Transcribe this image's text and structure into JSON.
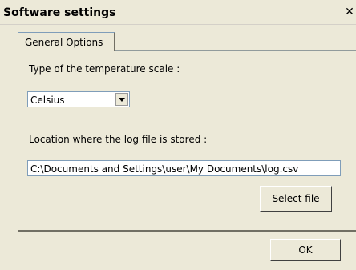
{
  "window": {
    "title": "Software settings",
    "close_glyph": "✕"
  },
  "tabs": [
    {
      "label": "General Options",
      "selected": true
    }
  ],
  "temperature": {
    "label": "Type of the temperature scale :",
    "selected_value": "Celsius"
  },
  "log": {
    "label": "Location where the log file is stored :",
    "path_value": "C:\\Documents and Settings\\user\\My Documents\\log.csv",
    "select_file_label": "Select file"
  },
  "footer": {
    "ok_label": "OK"
  }
}
